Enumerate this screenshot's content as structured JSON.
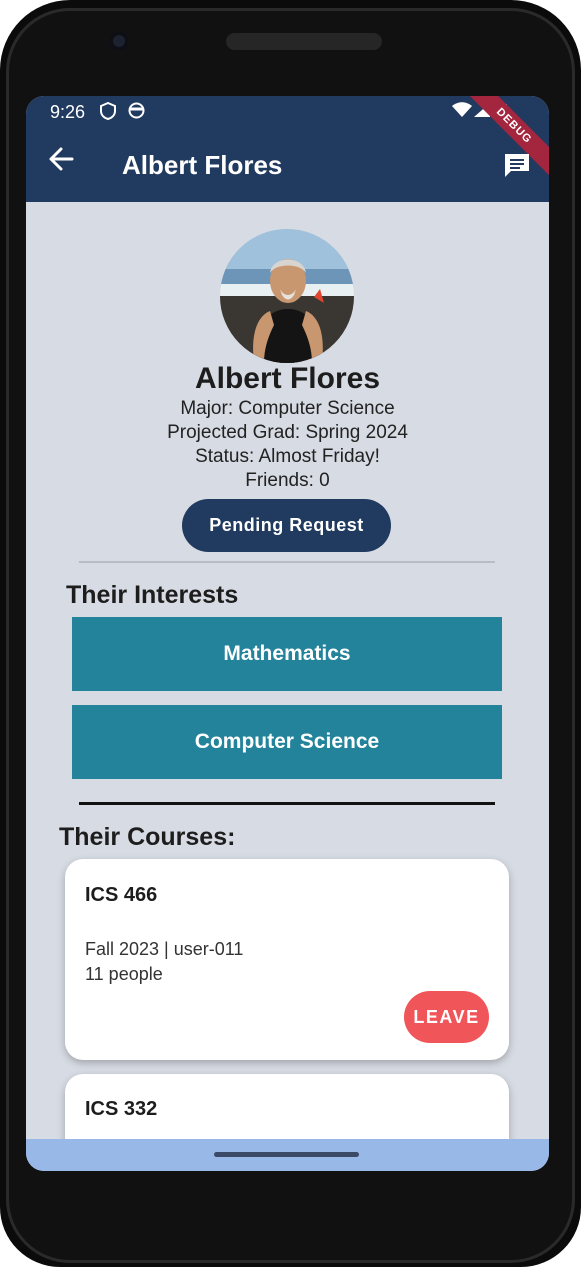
{
  "status_bar": {
    "time": "9:26",
    "debug_label": "DEBUG"
  },
  "app_bar": {
    "title": "Albert Flores",
    "back_icon": "arrow-back-icon",
    "action_icon": "message-icon"
  },
  "profile": {
    "name": "Albert Flores",
    "major": "Major: Computer Science",
    "grad": "Projected Grad: Spring 2024",
    "status": "Status: Almost Friday!",
    "friends": "Friends: 0",
    "request_button": "Pending Request"
  },
  "interests": {
    "heading": "Their Interests",
    "items": [
      {
        "label": "Mathematics"
      },
      {
        "label": "Computer Science"
      }
    ]
  },
  "courses": {
    "heading": "Their Courses:",
    "items": [
      {
        "code": "ICS 466",
        "meta": "Fall 2023 | user-011",
        "people": "11 people",
        "action": "LEAVE"
      },
      {
        "code": "ICS 332"
      }
    ]
  },
  "colors": {
    "app_bar": "#213a5f",
    "interest_tile": "#23839a",
    "leave_button": "#f0555a",
    "background": "#d7dbe3"
  }
}
